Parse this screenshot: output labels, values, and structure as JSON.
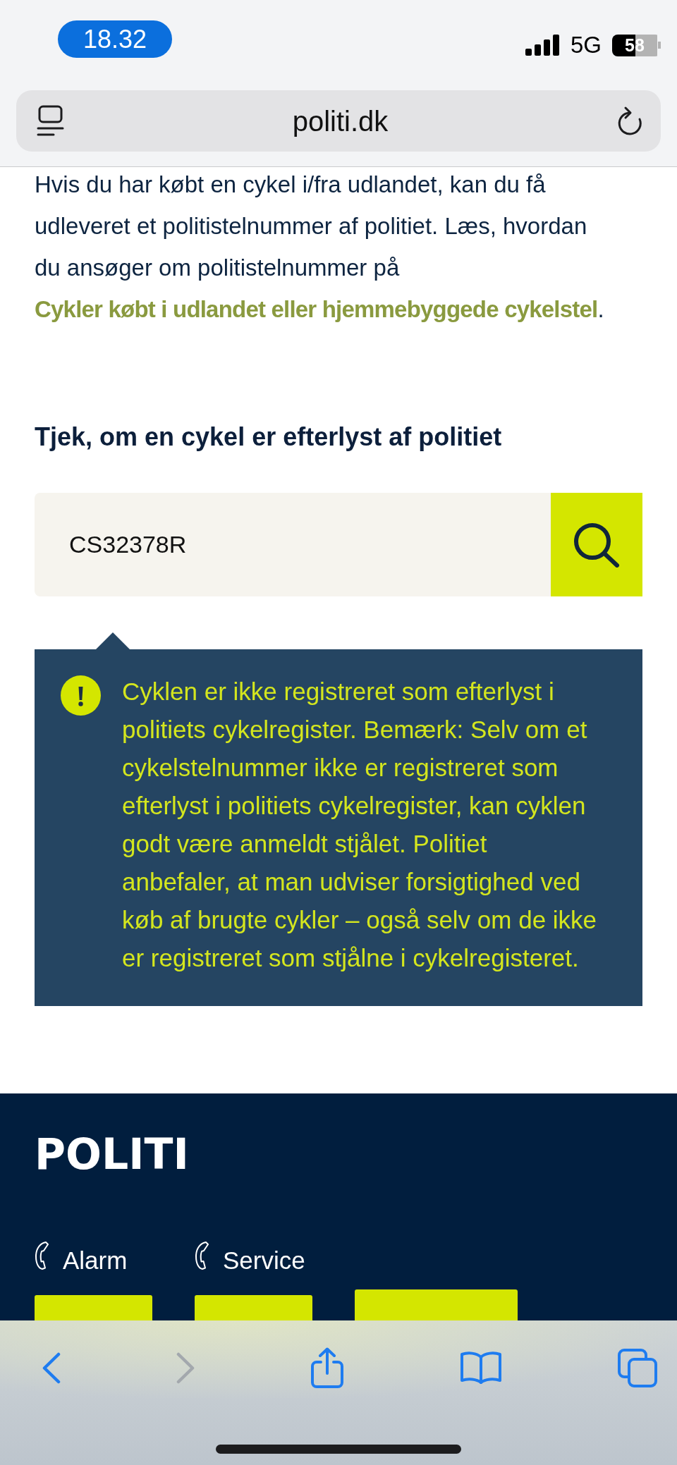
{
  "status_bar": {
    "time": "18.32",
    "network": "5G",
    "battery": "58"
  },
  "address_bar": {
    "url": "politi.dk"
  },
  "intro": {
    "text": "Hvis du har købt en cykel i/fra udlandet, kan du få udleveret et politistelnummer af politiet. Læs, hvordan du ansøger om politistelnummer på",
    "link": "Cykler købt i udlandet eller hjemmebyggede cykelstel",
    "text_after": "."
  },
  "search_section": {
    "title": "Tjek, om en cykel er efterlyst af politiet",
    "search": {
      "value": "CS32378R"
    }
  },
  "result": {
    "message": "Cyklen er ikke registreret som efterlyst i politiets cykelregister. Bemærk: Selv om et cykelstelnummer ikke er registreret som efterlyst i politiets cykelregister, kan cyklen godt være anmeldt stjålet. Politiet anbefaler, at man udviser forsigtighed ved køb af brugte cykler – også selv om de ikke er registreret som stjålne i cykelregisteret."
  },
  "footer": {
    "logo": "POLITI",
    "contacts": [
      {
        "label": "Alarm"
      },
      {
        "label": "Service"
      }
    ]
  },
  "browser_toolbar": {
    "back": {
      "disabled": false
    },
    "forward": {
      "disabled": true
    }
  }
}
